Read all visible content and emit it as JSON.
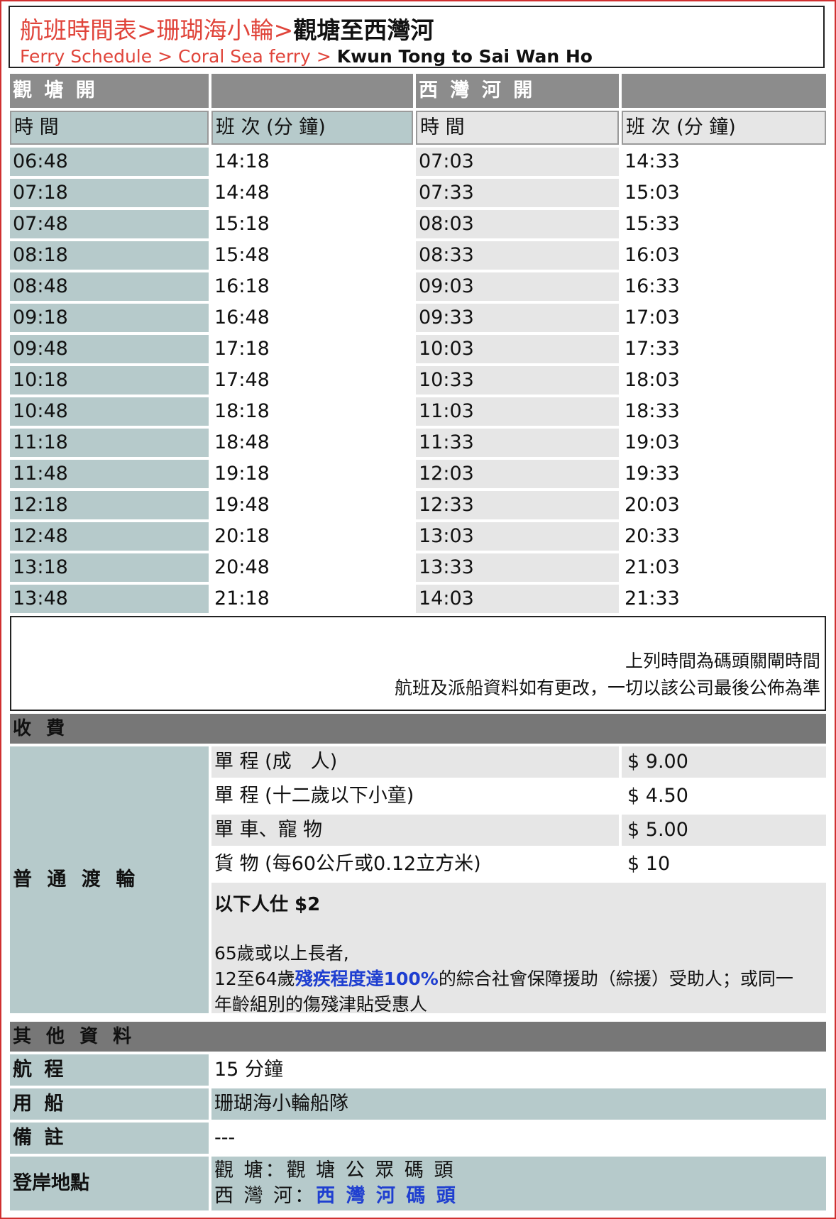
{
  "breadcrumb": {
    "zh": [
      "航班時間表",
      "珊瑚海小輪",
      "觀塘至西灣河"
    ],
    "en": [
      "Ferry Schedule",
      "Coral Sea ferry",
      "Kwun Tong to Sai Wan Ho"
    ],
    "separator": ">"
  },
  "schedule": {
    "from_a": "觀 塘 開",
    "from_b": "西 灣 河 開",
    "col_time": "時 間",
    "col_sailing": "班 次 (分 鐘)",
    "rows": [
      [
        "06:48",
        "14:18",
        "07:03",
        "14:33"
      ],
      [
        "07:18",
        "14:48",
        "07:33",
        "15:03"
      ],
      [
        "07:48",
        "15:18",
        "08:03",
        "15:33"
      ],
      [
        "08:18",
        "15:48",
        "08:33",
        "16:03"
      ],
      [
        "08:48",
        "16:18",
        "09:03",
        "16:33"
      ],
      [
        "09:18",
        "16:48",
        "09:33",
        "17:03"
      ],
      [
        "09:48",
        "17:18",
        "10:03",
        "17:33"
      ],
      [
        "10:18",
        "17:48",
        "10:33",
        "18:03"
      ],
      [
        "10:48",
        "18:18",
        "11:03",
        "18:33"
      ],
      [
        "11:18",
        "18:48",
        "11:33",
        "19:03"
      ],
      [
        "11:48",
        "19:18",
        "12:03",
        "19:33"
      ],
      [
        "12:18",
        "19:48",
        "12:33",
        "20:03"
      ],
      [
        "12:48",
        "20:18",
        "13:03",
        "20:33"
      ],
      [
        "13:18",
        "20:48",
        "13:33",
        "21:03"
      ],
      [
        "13:48",
        "21:18",
        "14:03",
        "21:33"
      ]
    ]
  },
  "notes": {
    "line1": "上列時間為碼頭關閘時間",
    "line2": "航班及派船資料如有更改，一切以該公司最後公佈為準"
  },
  "fares": {
    "title": "收 費",
    "category": "普 通 渡 輪",
    "items": [
      {
        "label": "單 程 (成　人)",
        "price": "$ 9.00"
      },
      {
        "label": "單 程 (十二歲以下小童)",
        "price": "$ 4.50"
      },
      {
        "label": "單 車、寵 物",
        "price": "$ 5.00"
      },
      {
        "label": "貨 物 (每60公斤或0.12立方米)",
        "price": "$ 10"
      }
    ],
    "concession_title": "以下人仕 $2",
    "concession_line1": "65歲或以上長者,",
    "concession_line2_a": "12至64歲",
    "concession_line2_b": "殘疾程度達100%",
    "concession_line2_c": "的綜合社會保障援助（綜援）受助人；或同一",
    "concession_line3": "年齡組別的傷殘津貼受惠人"
  },
  "other": {
    "title": "其 他 資 料",
    "journey_label": "航 程",
    "journey_value": "15 分鐘",
    "vessel_label": "用 船",
    "vessel_value": "珊瑚海小輪船隊",
    "remarks_label": "備 註",
    "remarks_value": "---",
    "pier_label": "登岸地點",
    "pier_a_label": "觀 塘：",
    "pier_a_value": "觀 塘 公 眾 碼 頭",
    "pier_b_label": "西 灣 河：",
    "pier_b_value": "西 灣 河 碼 頭"
  }
}
